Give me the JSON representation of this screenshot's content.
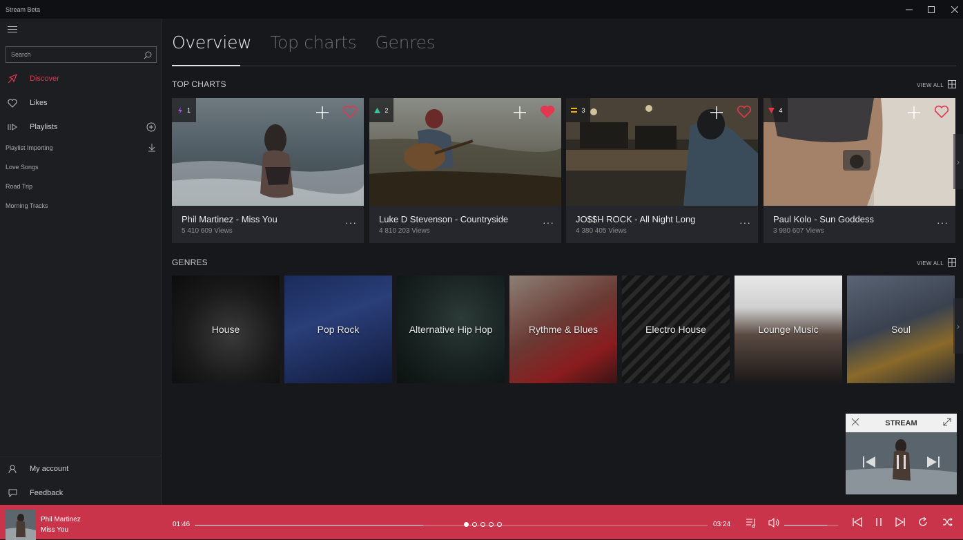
{
  "window": {
    "title": "Stream Beta"
  },
  "sidebar": {
    "search_placeholder": "Search",
    "nav": [
      {
        "label": "Discover"
      },
      {
        "label": "Likes"
      },
      {
        "label": "Playlists"
      }
    ],
    "playlists": [
      "Playlist Importing",
      "Love Songs",
      "Road Trip",
      "Morning Tracks"
    ],
    "bottom": [
      {
        "label": "My account"
      },
      {
        "label": "Feedback"
      }
    ]
  },
  "tabs": [
    "Overview",
    "Top charts",
    "Genres"
  ],
  "sections": {
    "top_charts": {
      "title": "TOP CHARTS",
      "view_all": "VIEW ALL"
    },
    "genres": {
      "title": "GENRES",
      "view_all": "VIEW ALL"
    }
  },
  "top_charts": [
    {
      "rank": "1",
      "trend": "hot",
      "title": "Phil Martinez - Miss You",
      "views": "5 410 609 Views",
      "liked": false
    },
    {
      "rank": "2",
      "trend": "up",
      "title": "Luke D Stevenson - Countryside",
      "views": "4 810 203 Views",
      "liked": true
    },
    {
      "rank": "3",
      "trend": "same",
      "title": "JO$$H ROCK - All Night Long",
      "views": "4 380 405 Views",
      "liked": false
    },
    {
      "rank": "4",
      "trend": "down",
      "title": "Paul Kolo - Sun Goddess",
      "views": "3 980 607 Views",
      "liked": false
    }
  ],
  "genres": [
    "House",
    "Pop Rock",
    "Alternative Hip Hop",
    "Rythme & Blues",
    "Electro House",
    "Lounge Music",
    "Soul"
  ],
  "mini_player": {
    "title": "STREAM"
  },
  "player": {
    "artist": "Phil Martinez",
    "song": "Miss You",
    "current_time": "01:46",
    "total_time": "03:24",
    "progress": 0.445,
    "volume": 0.8,
    "page_dots_total": 5,
    "page_dot_active": 0
  },
  "colors": {
    "accent": "#e2374f",
    "player_bg": "#c9344a",
    "trend_hot": "#b04fe0",
    "trend_up": "#35c3a0",
    "trend_same": "#f0b400",
    "trend_down": "#e2374f"
  }
}
